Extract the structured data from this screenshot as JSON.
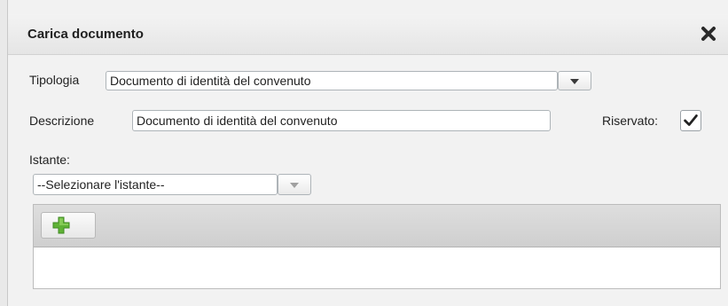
{
  "dialog": {
    "title": "Carica documento",
    "close_icon": "close-x-icon"
  },
  "form": {
    "tipologia_label": "Tipologia",
    "tipologia_value": "Documento di identità del convenuto",
    "descrizione_label": "Descrizione",
    "descrizione_value": "Documento di identità del convenuto",
    "riservato_label": "Riservato:",
    "riservato_checked": true,
    "istante_label": "Istante:",
    "istante_value": "--Selezionare l'istante--"
  },
  "toolbar": {
    "add_icon": "green-plus-icon"
  },
  "colors": {
    "title_bar": "#e9e9e9",
    "dialog_bg": "#f2f2f2",
    "add_icon_green": "#5fb236"
  }
}
